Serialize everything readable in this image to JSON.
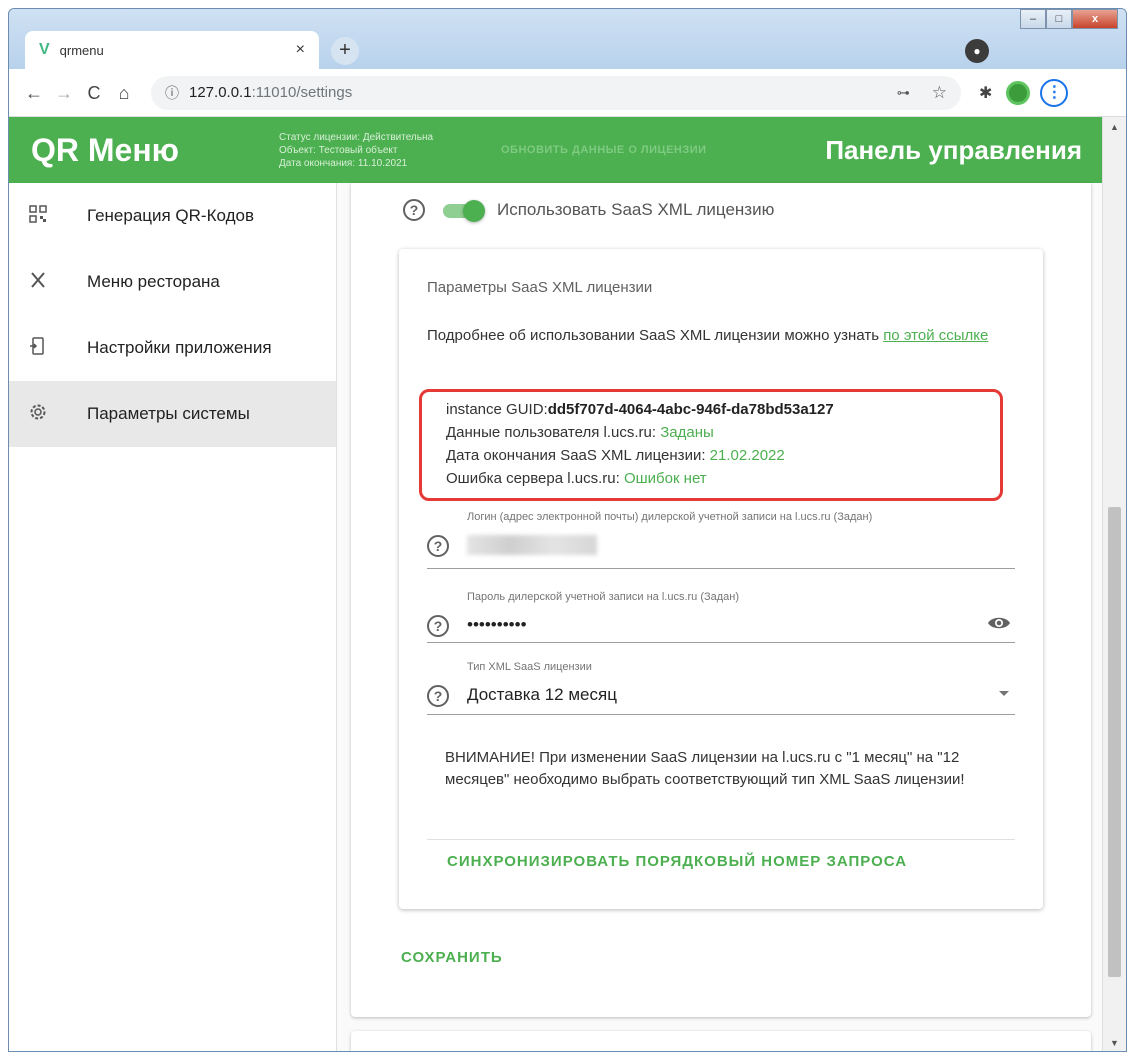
{
  "browser": {
    "tab_title": "qrmenu",
    "tab_close": "×",
    "new_tab": "+",
    "url_host": "127.0.0.1",
    "url_path": ":11010/settings",
    "back": "←",
    "forward": "→",
    "reload": "C",
    "home": "⌂",
    "info": "ⓘ",
    "window_controls": {
      "minimize": "–",
      "maximize": "□",
      "close": "x"
    }
  },
  "header": {
    "brand": "QR Меню",
    "license_status": "Статус лицензии: Действительна",
    "license_object": "Объект: Тестовый объект",
    "license_expiry": "Дата окончания: 11.10.2021",
    "refresh_license": "обновить данные о лицензии",
    "panel_title": "Панель управления"
  },
  "sidebar": {
    "items": [
      {
        "label": "Генерация QR-Кодов",
        "icon": "qr-code-icon",
        "active": false
      },
      {
        "label": "Меню ресторана",
        "icon": "fork-knife-icon",
        "active": false
      },
      {
        "label": "Настройки приложения",
        "icon": "settings-app-icon",
        "active": false
      },
      {
        "label": "Параметры системы",
        "icon": "gear-icon",
        "active": true
      }
    ]
  },
  "settings": {
    "saas_toggle_label": "Использовать SaaS XML лицензию",
    "saas_toggle_on": true,
    "params_title": "Параметры SaaS XML лицензии",
    "params_desc": "Подробнее об использовании SaaS XML лицензии можно узнать ",
    "params_link": "по этой ссылке",
    "status": {
      "guid_label": "instance GUID:",
      "guid_value": "dd5f707d-4064-4abc-946f-da78bd53a127",
      "user_label": "Данные пользователя l.ucs.ru: ",
      "user_value": "Заданы",
      "expiry_label": "Дата окончания SaaS XML лицензии: ",
      "expiry_value": "21.02.2022",
      "error_label": "Ошибка сервера l.ucs.ru: ",
      "error_value": "Ошибок нет"
    },
    "login_label": "Логин (адрес электронной почты) дилерской учетной записи на l.ucs.ru (Задан)",
    "password_label": "Пароль дилерской учетной записи на l.ucs.ru (Задан)",
    "password_value": "••••••••••",
    "license_type_label": "Тип XML SaaS лицензии",
    "license_type_value": "Доставка 12 месяц",
    "warning": "ВНИМАНИЕ! При изменении SaaS лицензии на l.ucs.ru с \"1 месяц\" на \"12 месяцев\" необходимо выбрать соответствующий тип XML SaaS лицензии!",
    "sync_button": "Синхронизировать порядковый номер запроса",
    "save_button": "Сохранить",
    "help_glyph": "?"
  },
  "colors": {
    "accent": "#4caf50",
    "highlight_border": "#e53935"
  }
}
